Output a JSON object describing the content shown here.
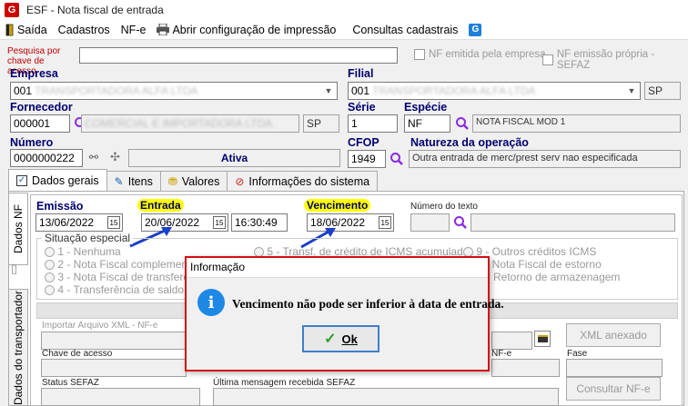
{
  "window": {
    "title": "ESF - Nota fiscal de entrada"
  },
  "menu": {
    "items": [
      "Saída",
      "Cadastros",
      "NF-e",
      "Abrir configuração de impressão",
      "Consultas cadastrais"
    ]
  },
  "search": {
    "label": "Pesquisa por chave de acesso",
    "value": ""
  },
  "checks": {
    "nf_emitida": "NF emitida pela empresa",
    "nf_emissao": "NF emissão própria - SEFAZ"
  },
  "empresa": {
    "label": "Empresa",
    "value": "001",
    "hidden": "TRANSPORTADORA ALFA LTDA"
  },
  "filial": {
    "label": "Filial",
    "value": "001",
    "hidden": "TRANSPORTADORA ALFA LTDA",
    "uf": "SP"
  },
  "fornecedor": {
    "label": "Fornecedor",
    "code": "000001",
    "name": "COMERCIAL E IMPORTADORA LTDA",
    "uf": "SP"
  },
  "serie": {
    "label": "Série",
    "value": "1"
  },
  "especie": {
    "label": "Espécie",
    "code": "NF",
    "desc": "NOTA FISCAL MOD 1"
  },
  "numero": {
    "label": "Número",
    "value": "0000000222",
    "status": "Ativa"
  },
  "cfop": {
    "label": "CFOP",
    "value": "1949"
  },
  "natureza": {
    "label": "Natureza da operação",
    "value": "Outra entrada de merc/prest serv nao especificada"
  },
  "tabs": [
    "Dados gerais",
    "Itens",
    "Valores",
    "Informações do sistema"
  ],
  "vtabs": [
    "Dados NF",
    "Dados do transportador"
  ],
  "dates": {
    "emissao_label": "Emissão",
    "emissao": "13/06/2022",
    "entrada_label": "Entrada",
    "entrada": "20/06/2022",
    "hora": "16:30:49",
    "venc_label": "Vencimento",
    "vencimento": "18/06/2022",
    "numtexto_label": "Número do texto"
  },
  "situacao": {
    "label": "Situação especial",
    "left": [
      "1 - Nenhuma",
      "2 - Nota Fiscal complementar",
      "3 - Nota Fiscal de transferência",
      "4 - Transferência de saldo de ICMS"
    ],
    "mid": [
      "5 - Transf. de crédito de ICMS acumulado"
    ],
    "right": [
      "9 - Outros créditos ICMS",
      "A - Nota Fiscal de estorno",
      "B - Retorno de armazenagem"
    ]
  },
  "nfe": {
    "xml_label": "Importar Arquivo XML - NF-e",
    "chave_label": "Chave de acesso",
    "nfe_suffix": "NF-e",
    "fase_label": "Fase",
    "status_label": "Status SEFAZ",
    "msg_label": "Última mensagem recebida SEFAZ",
    "xml_btn": "XML anexado",
    "consultar_btn": "Consultar NF-e"
  },
  "dialog": {
    "title": "Informação",
    "message": "Vencimento não pode ser inferior à data de entrada.",
    "ok": "Ok"
  },
  "colors": {
    "accent": "#00006e",
    "highlight": "#ffff00",
    "dialog_border": "#d01010"
  }
}
